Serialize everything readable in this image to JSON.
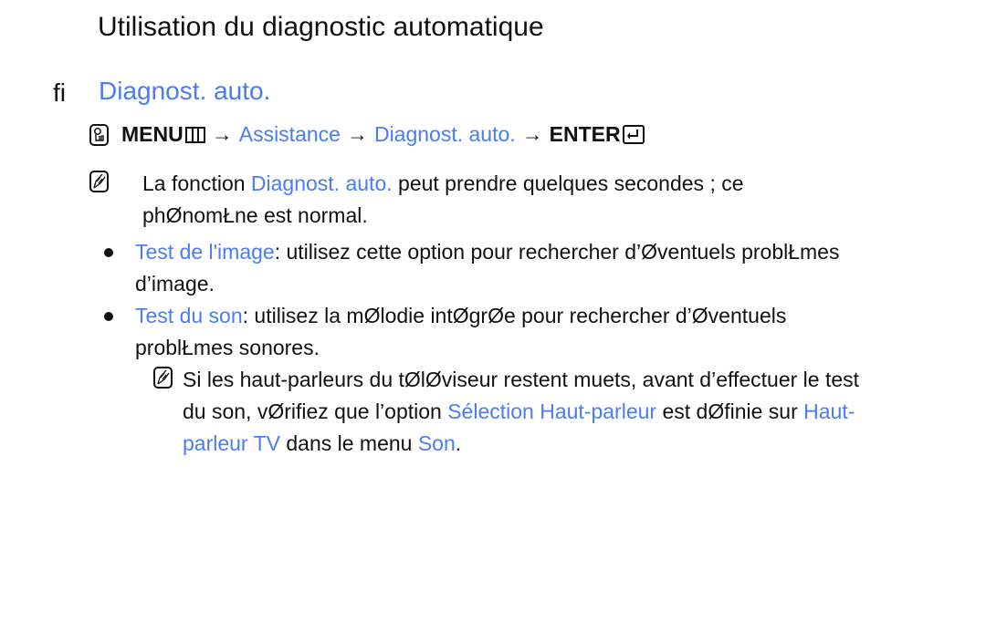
{
  "page": {
    "title": "Utilisation du diagnostic automatique",
    "section_marker": "ﬁ",
    "section_title": "Diagnost. auto."
  },
  "menu_path": {
    "menu_label": "MENU",
    "arrow": "→",
    "step1": "Assistance",
    "step2": "Diagnost. auto.",
    "enter_label": "ENTER"
  },
  "note1": {
    "pre": "La fonction ",
    "link": "Diagnost. auto.",
    "post": " peut prendre quelques secondes ; ce",
    "line2": "phØnomŁne est normal."
  },
  "bullets": [
    {
      "term": "Test de l'image",
      "text": ": utilisez cette option pour rechercher d’Øventuels problŁmes",
      "line2": "d’image."
    },
    {
      "term": "Test du son",
      "text": ": utilisez la mØlodie intØgrØe pour rechercher d’Øventuels",
      "line2": "problŁmes sonores."
    }
  ],
  "note2": {
    "line1": "Si les haut-parleurs du tØlØviseur restent muets, avant d’effectuer le test",
    "line2_pre": "du son, vØrifiez que l’option ",
    "line2_link1": "Sélection Haut-parleur",
    "line2_mid": " est dØfinie sur ",
    "line2_link2a": "Haut-",
    "line3_link2b": "parleur TV",
    "line3_mid": " dans le menu ",
    "line3_link3": "Son",
    "line3_end": "."
  },
  "colors": {
    "accent_blue": "#4a7cf5",
    "text": "#111111"
  }
}
